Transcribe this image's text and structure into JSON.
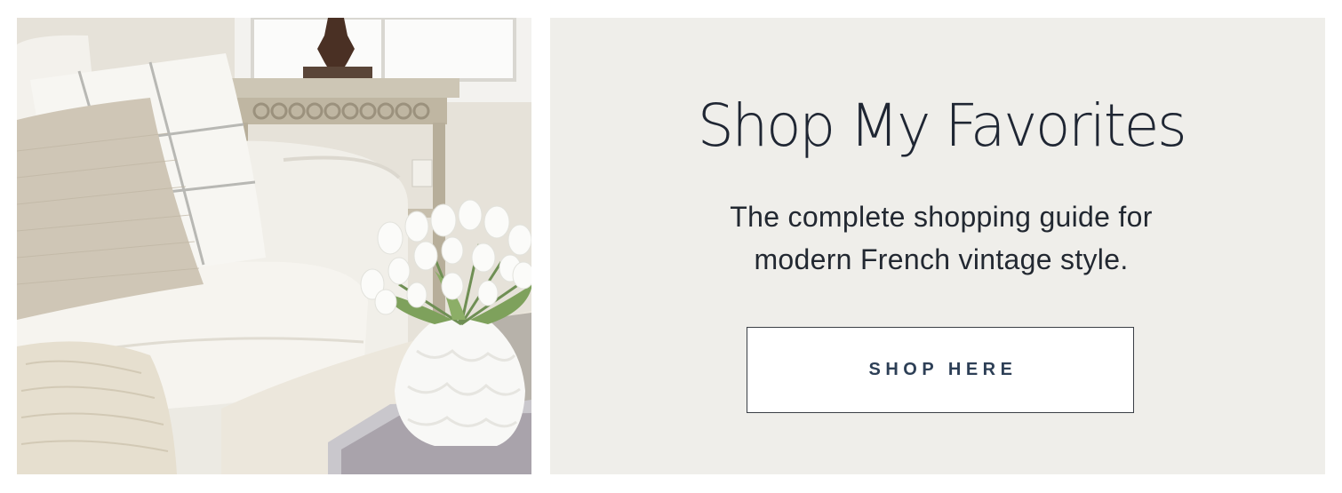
{
  "banner": {
    "title": "Shop My Favorites",
    "subtitle_line1": "The complete shopping guide for",
    "subtitle_line2": "modern French vintage style.",
    "button_label": "SHOP HERE"
  },
  "colors": {
    "panel_background": "#efeeea",
    "title_text": "#1f2633",
    "button_text": "#2d3f56",
    "button_border": "#3b3f46"
  },
  "photo": {
    "subject": "white slipcovered armchair with pillows, white tulips in a white vase on a coffee table, console table with lamp"
  }
}
